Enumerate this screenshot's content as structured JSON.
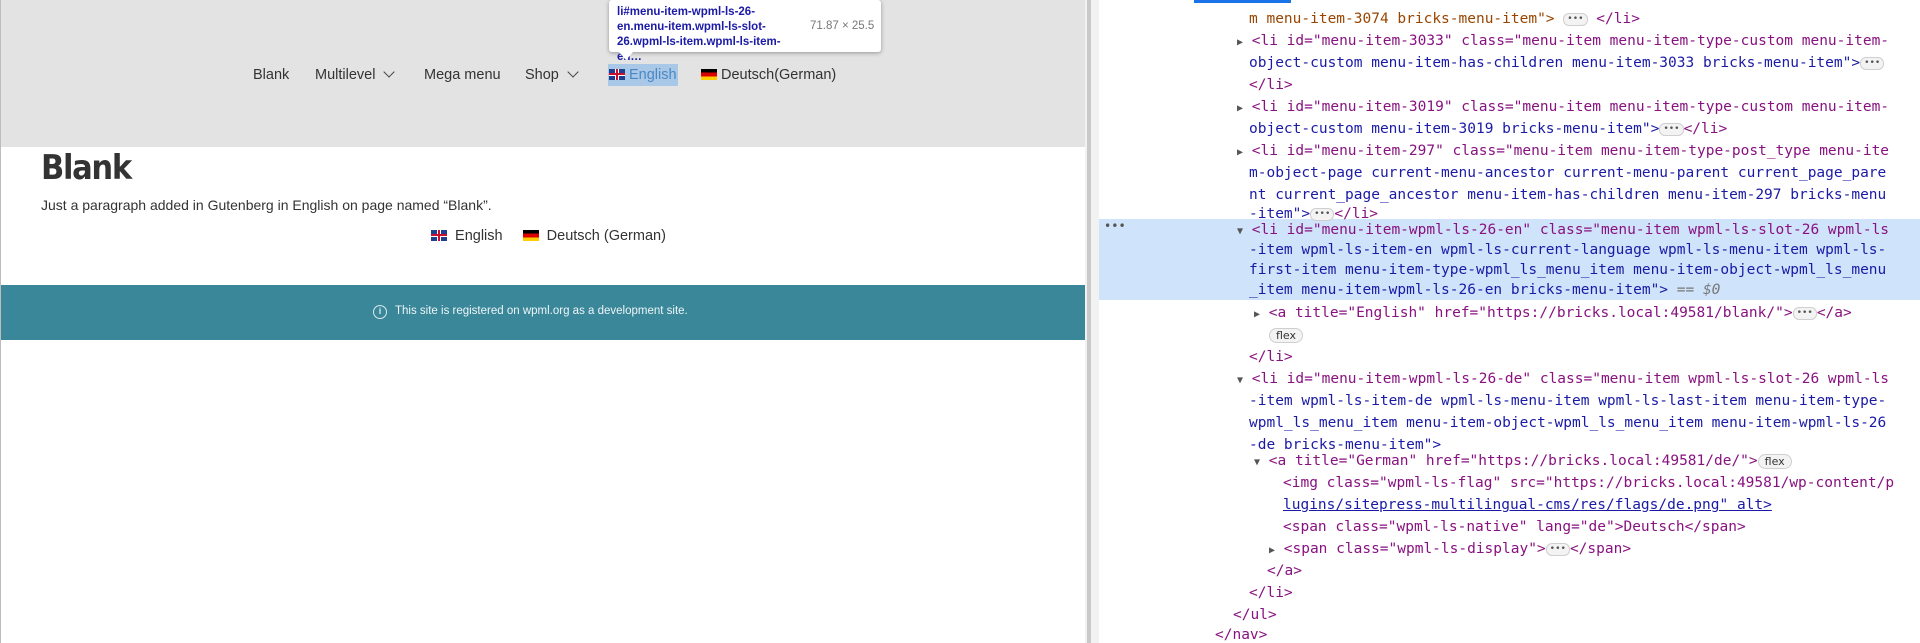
{
  "page": {
    "nav": {
      "items": [
        {
          "label": "Blank"
        },
        {
          "label": "Multilevel"
        },
        {
          "label": "Mega menu"
        },
        {
          "label": "Shop"
        },
        {
          "label": "English"
        },
        {
          "label": "Deutsch(German)"
        }
      ]
    },
    "tooltip": {
      "selector": "li#menu-item-wpml-ls-26-en.menu-item.wpml-ls-slot-26.wpml-ls-item.wpml-ls-item-en…",
      "dimensions": "71.87 × 25.5"
    },
    "title": "Blank",
    "paragraph": "Just a paragraph added in Gutenberg in English on page named “Blank”.",
    "lang_switcher": {
      "english": "English",
      "german": "Deutsch (German)"
    },
    "dev_banner": "This site is registered on wpml.org as a development site.",
    "colors": {
      "header_bg": "#e3e3e3",
      "banner_bg": "#398799",
      "highlight": "#a9c7e6"
    }
  },
  "devtools": {
    "lines": [
      {
        "t": "m menu-item-3074 bricks-menu-item\">",
        "tail": "</li>"
      },
      {
        "t": "<li id=\"menu-item-3033\" class=\"menu-item menu-item-type-custom menu-item-"
      },
      {
        "t": "object-custom menu-item-has-children menu-item-3033 bricks-menu-item\">"
      },
      {
        "t": "</li>"
      },
      {
        "t": "<li id=\"menu-item-3019\" class=\"menu-item menu-item-type-custom menu-item-"
      },
      {
        "t": "object-custom menu-item-3019 bricks-menu-item\">",
        "tail": "</li>"
      },
      {
        "t": "<li id=\"menu-item-297\" class=\"menu-item menu-item-type-post_type menu-ite"
      },
      {
        "t": "m-object-page current-menu-ancestor current-menu-parent current_page_pare"
      },
      {
        "t": "nt current_page_ancestor menu-item-has-children menu-item-297 bricks-menu"
      },
      {
        "t": "-item\">",
        "tail": "</li>"
      },
      {
        "t": "<li id=\"menu-item-wpml-ls-26-en\" class=\"menu-item wpml-ls-slot-26 wpml-ls"
      },
      {
        "t": "-item wpml-ls-item-en wpml-ls-current-language wpml-ls-menu-item wpml-ls-"
      },
      {
        "t": "first-item menu-item-type-wpml_ls_menu_item menu-item-object-wpml_ls_menu"
      },
      {
        "t": "_item menu-item-wpml-ls-26-en bricks-menu-item\">",
        "tail": "== $0"
      },
      {
        "t": "<a title=\"English\" href=\"https://bricks.local:49581/blank/\">",
        "tail": "</a>"
      },
      {
        "t": "flex"
      },
      {
        "t": "</li>"
      },
      {
        "t": "<li id=\"menu-item-wpml-ls-26-de\" class=\"menu-item wpml-ls-slot-26 wpml-ls"
      },
      {
        "t": "-item wpml-ls-item-de wpml-ls-menu-item wpml-ls-last-item menu-item-type-"
      },
      {
        "t": "wpml_ls_menu_item menu-item-object-wpml_ls_menu_item menu-item-wpml-ls-26"
      },
      {
        "t": "-de bricks-menu-item\">"
      },
      {
        "t": "<a title=\"German\" href=\"https://bricks.local:49581/de/\">",
        "tail": "flex"
      },
      {
        "t": "<img class=\"wpml-ls-flag\" src=\"https://bricks.local:49581/wp-content/p"
      },
      {
        "t": "lugins/sitepress-multilingual-cms/res/flags/de.png\" alt>"
      },
      {
        "t": "<span class=\"wpml-ls-native\" lang=\"de\">Deutsch</span>"
      },
      {
        "t": "<span class=\"wpml-ls-display\">",
        "tail": "</span>"
      },
      {
        "t": "</a>"
      },
      {
        "t": "</li>"
      },
      {
        "t": "</ul>"
      },
      {
        "t": "</nav>"
      }
    ]
  }
}
